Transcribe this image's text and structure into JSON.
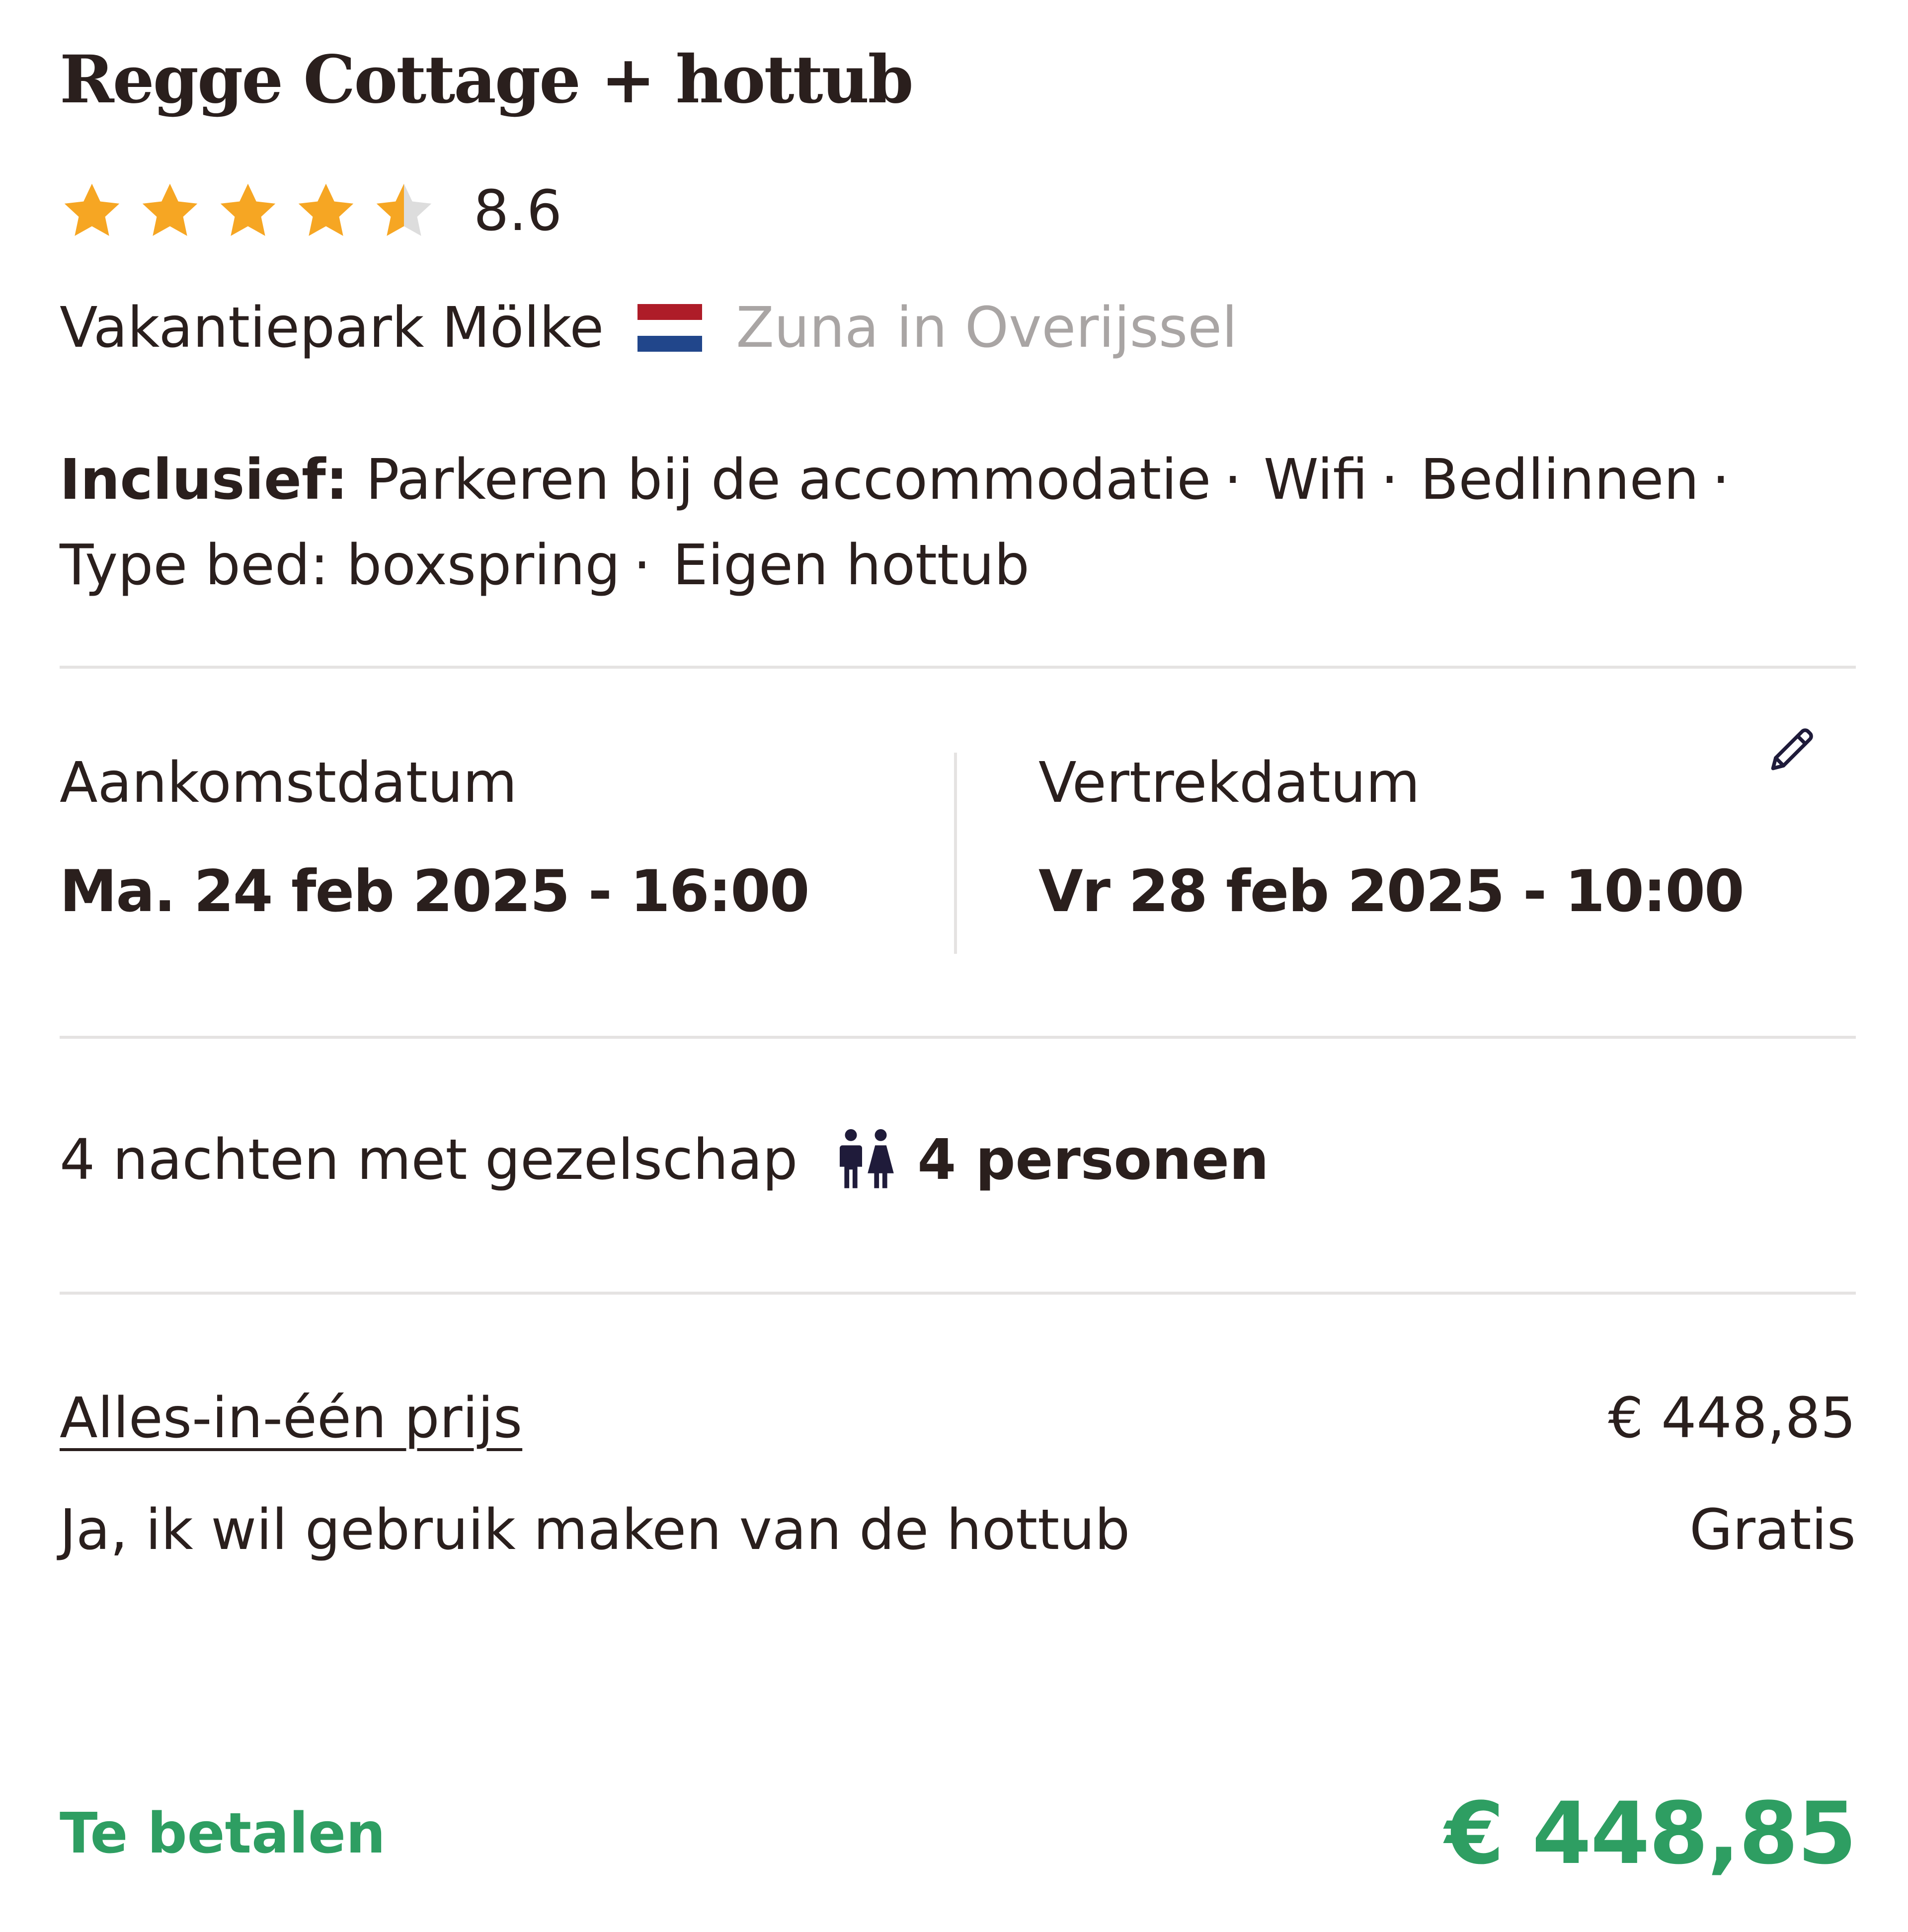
{
  "accommodation": {
    "title": "Regge Cottage + hottub",
    "rating": {
      "score": "8.6",
      "stars_filled": 4.5,
      "stars_total": 5,
      "star_color": "#f6a623",
      "star_empty_color": "#dddddd"
    },
    "park": "Vakantiepark Mölke",
    "country_flag": "netherlands-flag-icon",
    "flag_colors": [
      "#ae1c28",
      "#ffffff",
      "#21468b"
    ],
    "region": "Zuna in Overijssel"
  },
  "inclusions": {
    "label": "Inclusief:",
    "items": [
      "Parkeren bij de accommodatie",
      "Wifi",
      "Bedlinnen",
      "Type bed: boxspring",
      "Eigen hottub"
    ],
    "separator": "·"
  },
  "dates": {
    "arrival_label": "Aankomstdatum",
    "arrival_value": "Ma. 24 feb 2025 - 16:00",
    "departure_label": "Vertrekdatum",
    "departure_value": "Vr 28 feb 2025 - 10:00",
    "edit_icon": "pencil-icon"
  },
  "party": {
    "nights_text": "4 nachten met gezelschap",
    "persons_icon": "persons-icon",
    "persons_text": "4 personen"
  },
  "pricing": {
    "lines": [
      {
        "label": "Alles-in-één prijs",
        "value": "€ 448,85"
      },
      {
        "label": "Ja, ik wil gebruik maken van de hottub",
        "value": "Gratis"
      }
    ],
    "total_label": "Te betalen",
    "total_value": "€ 448,85",
    "total_color": "#2e9e62"
  }
}
